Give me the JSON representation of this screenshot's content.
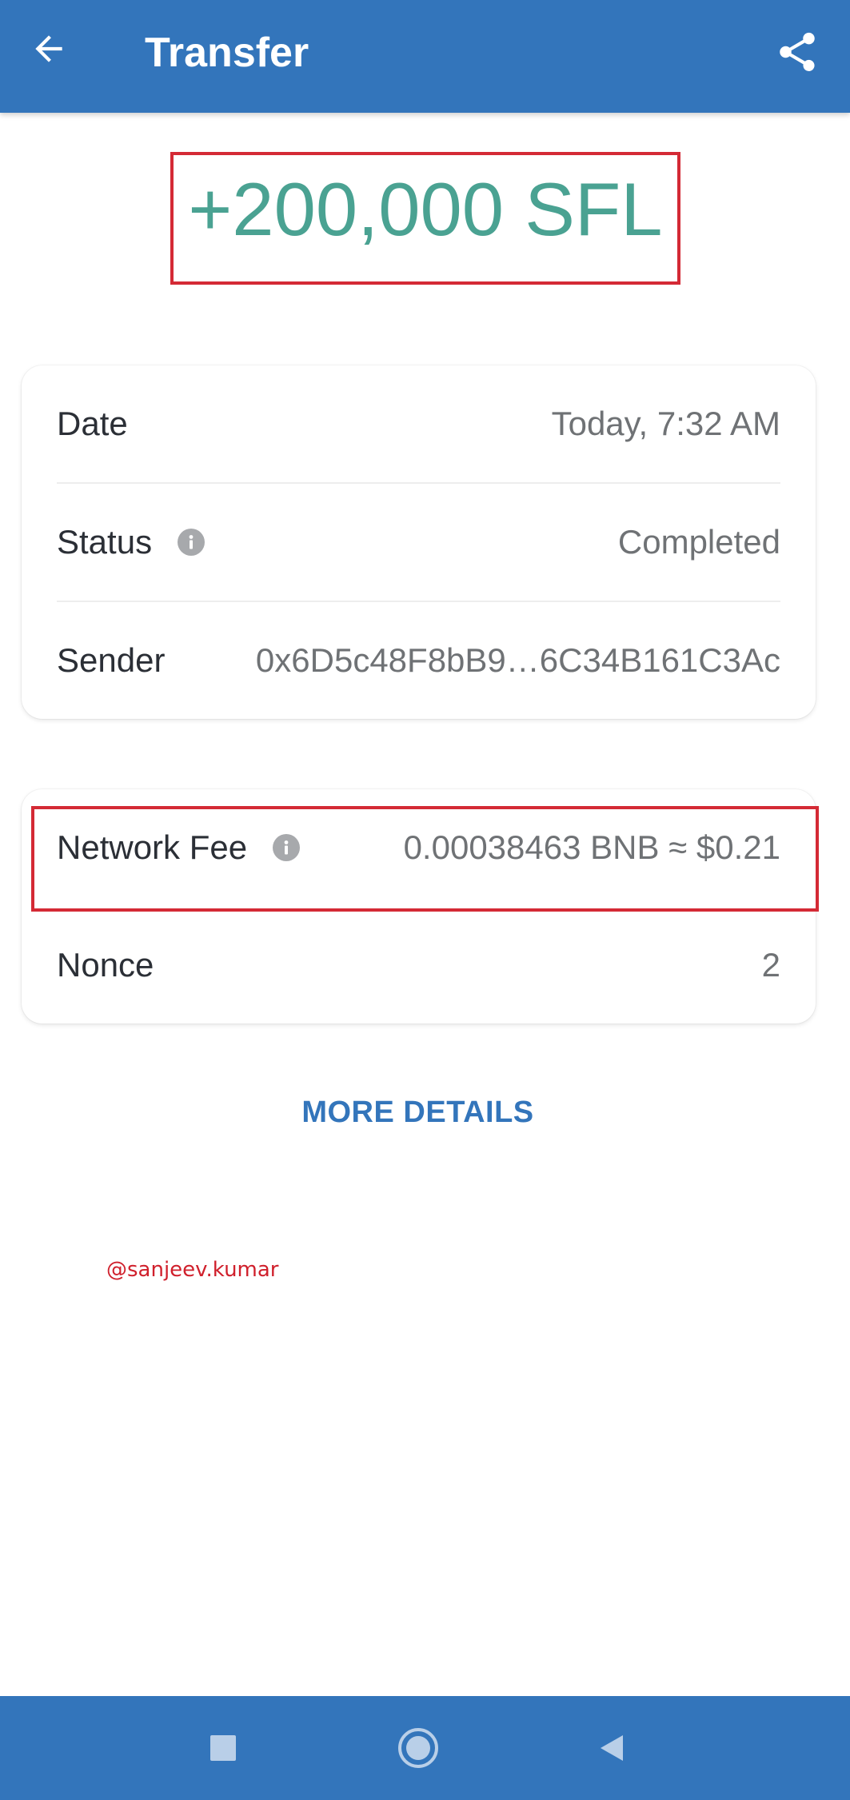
{
  "header": {
    "title": "Transfer",
    "back_icon": "arrow-left-icon",
    "share_icon": "share-icon"
  },
  "transaction": {
    "amount": "+200,000 SFL"
  },
  "details": {
    "date_label": "Date",
    "date_value": "Today, 7:32 AM",
    "status_label": "Status",
    "status_value": "Completed",
    "sender_label": "Sender",
    "sender_value": "0x6D5c48F8bB9…6C34B161C3Ac"
  },
  "fee": {
    "network_fee_label": "Network Fee",
    "network_fee_value": "0.00038463 BNB ≈ $0.21",
    "nonce_label": "Nonce",
    "nonce_value": "2"
  },
  "actions": {
    "more_details_label": "MORE DETAILS"
  },
  "watermark": {
    "text": "@sanjeev.kumar"
  },
  "navigation": {
    "recent_icon": "square-icon",
    "home_icon": "circle-home-icon",
    "back_icon": "triangle-back-icon"
  },
  "colors": {
    "primary": "#3375bb",
    "amount_green": "#4aa292",
    "highlight_red": "#d42a35",
    "info_gray": "#a7a9ac"
  }
}
